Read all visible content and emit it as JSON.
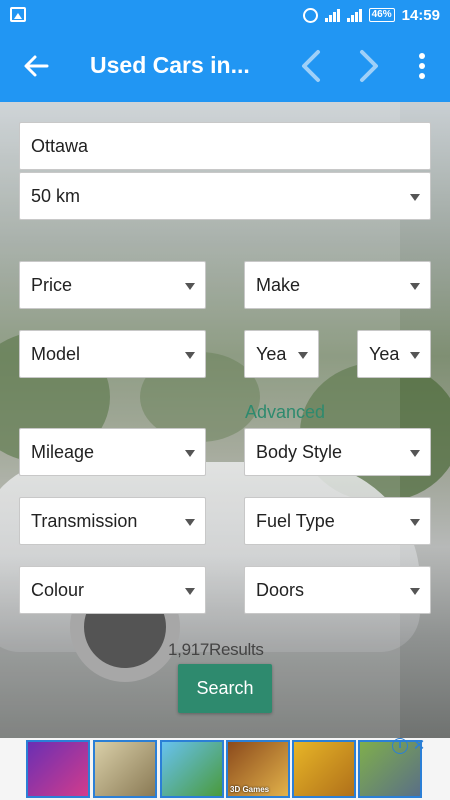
{
  "status_bar": {
    "battery": "46%",
    "time": "14:59"
  },
  "app_bar": {
    "title": "Used Cars in..."
  },
  "form": {
    "location_value": "Ottawa",
    "radius_value": "50 km",
    "price_label": "Price",
    "make_label": "Make",
    "model_label": "Model",
    "year_from_label": "Yea",
    "year_to_label": "Yea",
    "advanced_link": "Advanced",
    "mileage_label": "Mileage",
    "body_style_label": "Body Style",
    "transmission_label": "Transmission",
    "fuel_type_label": "Fuel Type",
    "colour_label": "Colour",
    "doors_label": "Doors",
    "results_text": "1,917Results",
    "search_button": "Search"
  },
  "ad_bar": {
    "tiles": [
      "candy-crush",
      "grand-theft-auto",
      "swampy",
      "fruit-ninja",
      "temple-run",
      "minecraft"
    ],
    "tile_captions": [
      "",
      "",
      "",
      "3D Games",
      "",
      ""
    ]
  },
  "colors": {
    "primary": "#2196f3",
    "accent": "#2e8a6e"
  }
}
